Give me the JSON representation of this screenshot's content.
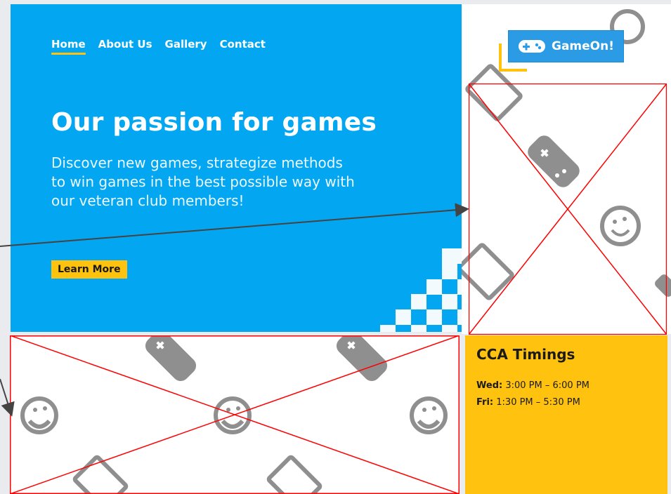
{
  "nav": [
    {
      "label": "Home",
      "active": true
    },
    {
      "label": "About Us",
      "active": false
    },
    {
      "label": "Gallery",
      "active": false
    },
    {
      "label": "Contact",
      "active": false
    }
  ],
  "hero": {
    "title": "Our passion for games",
    "description": "Discover new games, strategize methods to win games in the best possible way with our veteran club members!",
    "button": "Learn More"
  },
  "logo": {
    "text": "GameOn!",
    "icon": "gamepad-icon"
  },
  "cca": {
    "title": "CCA Timings",
    "rows": [
      {
        "day": "Wed:",
        "time": "3:00 PM – 6:00 PM"
      },
      {
        "day": "Fri:",
        "time": "1:30 PM – 5:30 PM"
      }
    ]
  },
  "colors": {
    "hero_blue": "#03a6f1",
    "accent_yellow": "#ffc20e",
    "placeholder_red": "#ff0000",
    "annotation_arrow": "#444444",
    "icon_gray": "#8f8f8f"
  }
}
